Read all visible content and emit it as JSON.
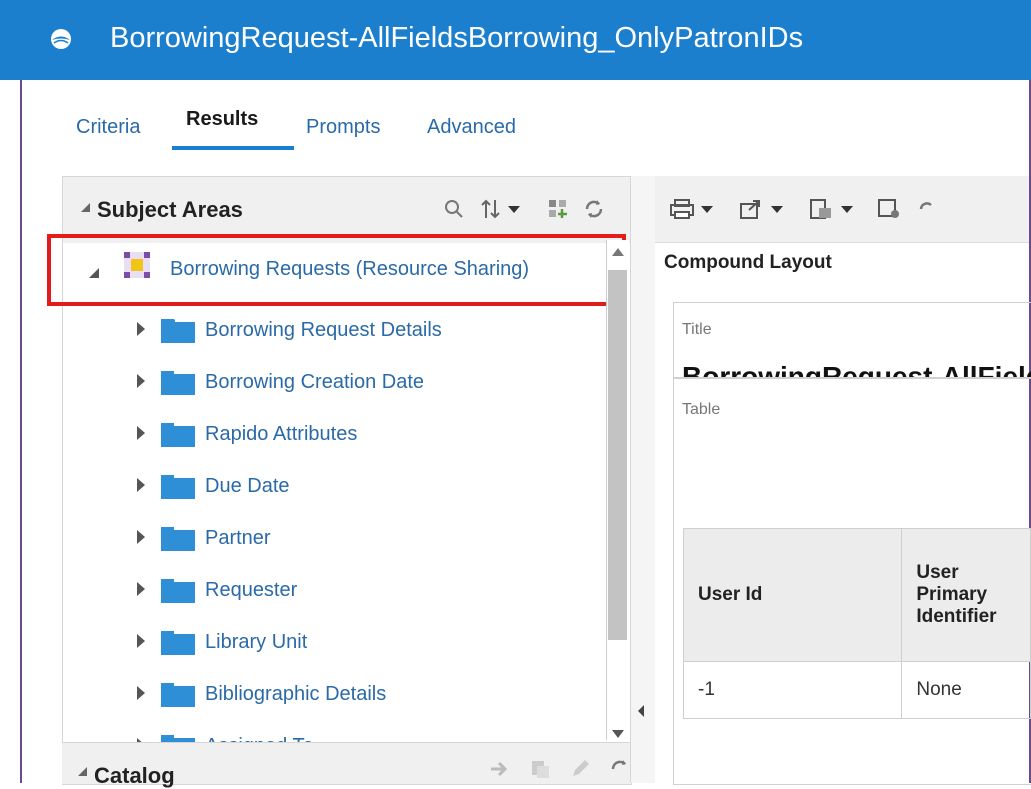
{
  "window": {
    "title": "BorrowingRequest-AllFieldsBorrowing_OnlyPatronIDs",
    "accent": "#1b7fce",
    "highlight_color": "#e41b1b"
  },
  "tabs": [
    {
      "label": "Criteria"
    },
    {
      "label": "Results",
      "active": true
    },
    {
      "label": "Prompts"
    },
    {
      "label": "Advanced"
    }
  ],
  "subject_areas": {
    "header": "Subject Areas",
    "root": {
      "label": "Borrowing Requests (Resource Sharing)"
    },
    "folders": [
      {
        "label": "Borrowing Request Details"
      },
      {
        "label": "Borrowing Creation Date"
      },
      {
        "label": "Rapido Attributes"
      },
      {
        "label": "Due Date"
      },
      {
        "label": "Partner"
      },
      {
        "label": "Requester"
      },
      {
        "label": "Library Unit"
      },
      {
        "label": "Bibliographic Details"
      },
      {
        "label": "Assigned To"
      }
    ]
  },
  "catalog": {
    "header": "Catalog"
  },
  "results": {
    "compound_layout": "Compound Layout",
    "title_view": {
      "caption": "Title",
      "text": "BorrowingRequest-AllFieldsBorrowing_OnlyPatronIDs"
    },
    "table_view": {
      "caption": "Table"
    },
    "table": {
      "columns": [
        "User Id",
        "User Primary Identifier"
      ],
      "rows": [
        [
          "-1",
          "None"
        ]
      ]
    }
  }
}
